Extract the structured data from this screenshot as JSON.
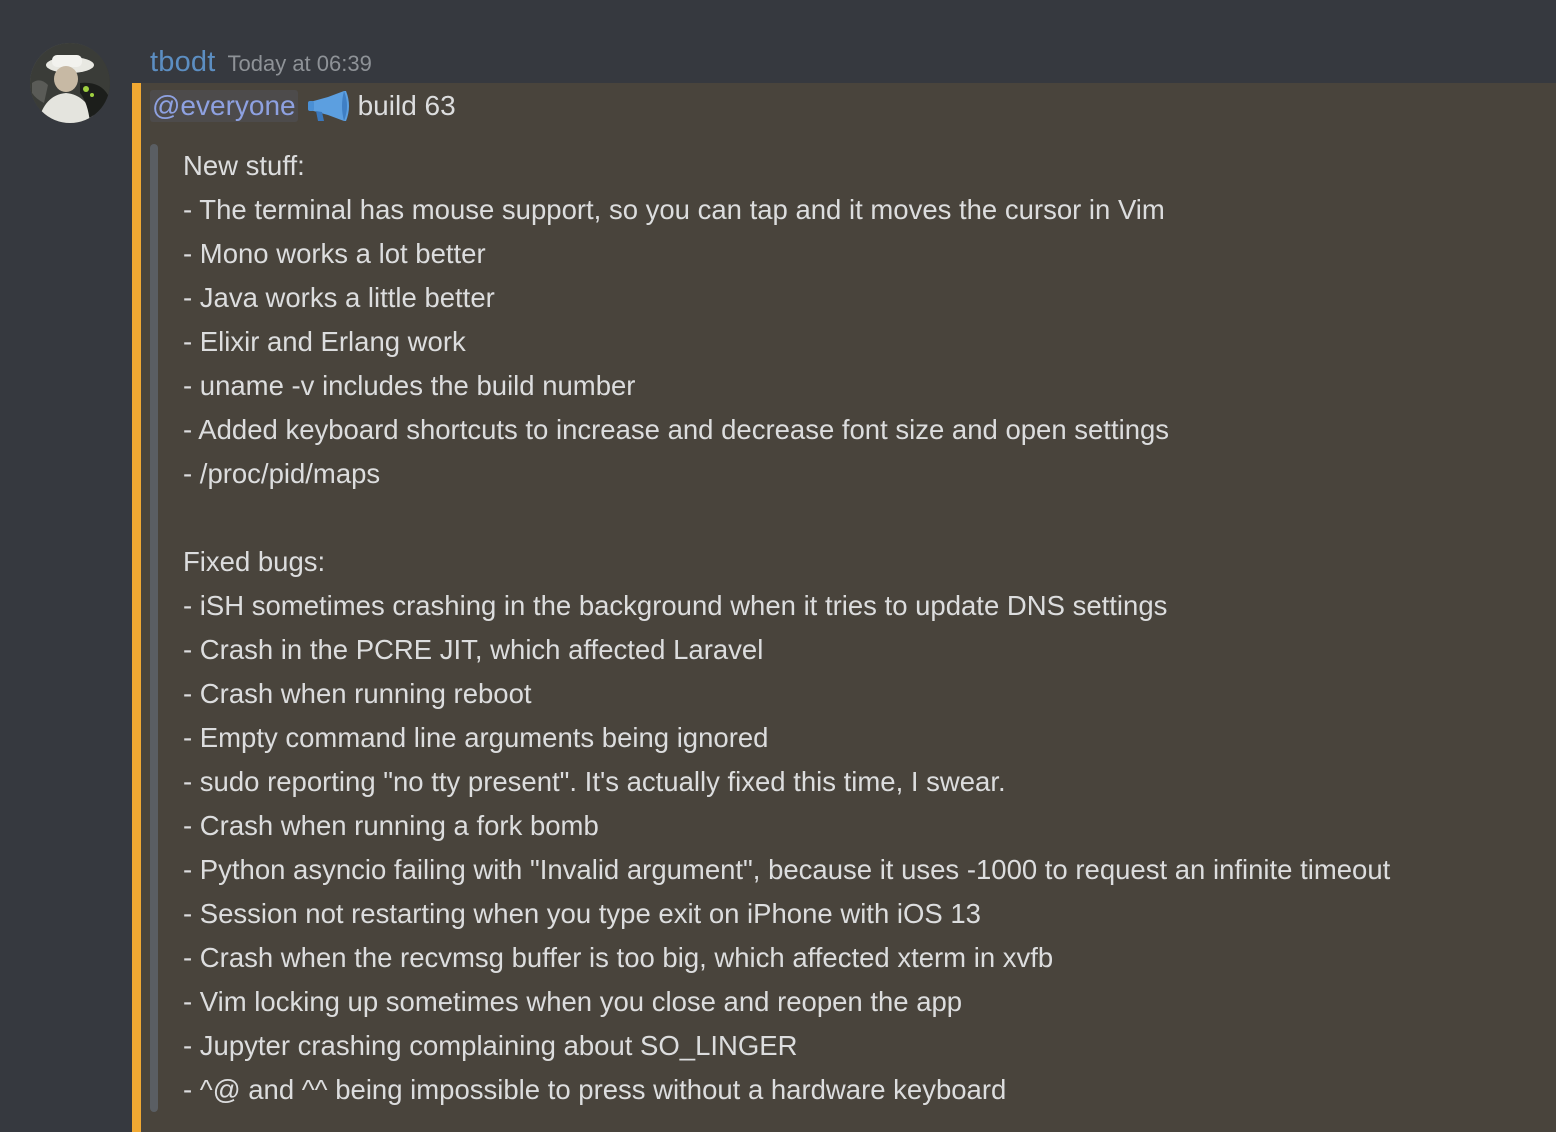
{
  "message": {
    "author": "tbodt",
    "timestamp": "Today at 06:39",
    "mention": "@everyone",
    "emoji": "loudspeaker-icon",
    "title_text": "build 63",
    "new_stuff_heading": "New stuff:",
    "new_stuff": [
      "- The terminal has mouse support, so you can tap and it moves the cursor in Vim",
      "- Mono works a lot better",
      "- Java works a little better",
      "- Elixir and Erlang work",
      "- uname -v includes the build number",
      "- Added keyboard shortcuts to increase and decrease font size and open settings",
      "- /proc/pid/maps"
    ],
    "fixed_bugs_heading": "Fixed bugs:",
    "fixed_bugs": [
      "- iSH sometimes crashing in the background when it tries to update DNS settings",
      "- Crash in the PCRE JIT, which affected Laravel",
      "- Crash when running reboot",
      "- Empty command line arguments being ignored",
      "- sudo reporting \"no tty present\". It's actually fixed this time, I swear.",
      "- Crash when running a fork bomb",
      "- Python asyncio failing with \"Invalid argument\", because it uses -1000 to request an infinite timeout",
      "- Session not restarting when you type exit on iPhone with iOS 13",
      "- Crash when the recvmsg buffer is too big, which affected xterm in xvfb",
      "- Vim locking up sometimes when you close and reopen the app",
      "- Jupyter crashing complaining about SO_LINGER",
      "- ^@ and ^^ being impossible to press without a hardware keyboard"
    ]
  },
  "colors": {
    "background": "#36393f",
    "mention_highlight": "#49443c",
    "mention_accent": "#f0a832",
    "username": "#5c8ec2",
    "mention_text": "#8ea1e1",
    "body_text": "#dcddde",
    "timestamp": "#8e9297",
    "quote_bar": "#5a5e63"
  }
}
